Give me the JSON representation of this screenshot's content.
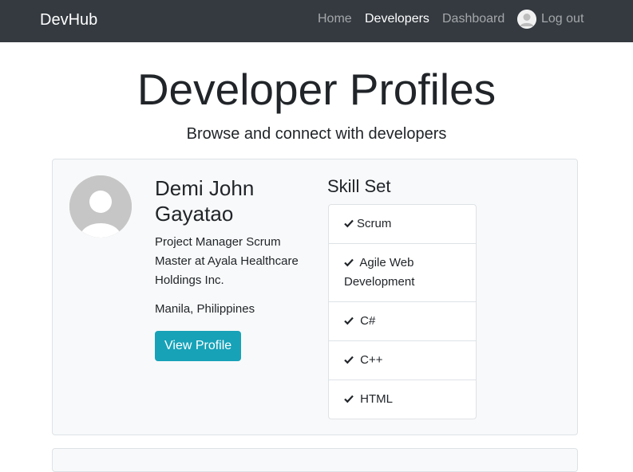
{
  "navbar": {
    "brand": "DevHub",
    "links": [
      {
        "label": "Home"
      },
      {
        "label": "Developers"
      },
      {
        "label": "Dashboard"
      }
    ],
    "logout_label": "Log out"
  },
  "header": {
    "title": "Developer Profiles",
    "lead": "Browse and connect with developers"
  },
  "profiles": [
    {
      "name": "Demi John Gayatao",
      "title": "Project Manager Scrum Master at Ayala Healthcare Holdings Inc.",
      "location": "Manila, Philippines",
      "button_label": "View Profile",
      "skills_heading": "Skill Set",
      "skills": [
        "Scrum",
        "Agile Web Development",
        "C#",
        "C++",
        "HTML"
      ]
    }
  ],
  "colors": {
    "navbar_bg": "#343a40",
    "button_bg": "#17a2b8",
    "card_bg": "#f8f9fa"
  }
}
